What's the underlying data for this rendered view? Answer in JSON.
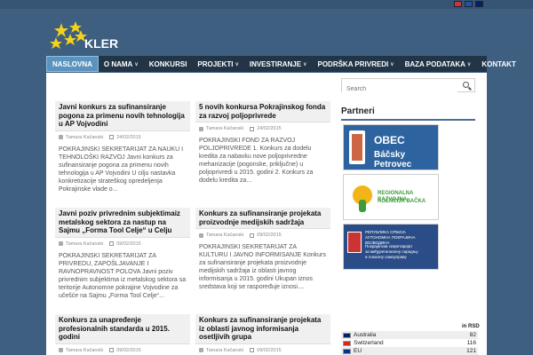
{
  "header": {
    "logo_text": "KLER",
    "languages": [
      {
        "code": "sr",
        "color": "#c6363c"
      },
      {
        "code": "ru",
        "color": "#1c57a5"
      },
      {
        "code": "en",
        "color": "#012169"
      }
    ]
  },
  "nav": {
    "items": [
      {
        "label": "NASLOVNA",
        "active": true,
        "has_menu": false
      },
      {
        "label": "O NAMA",
        "active": false,
        "has_menu": true
      },
      {
        "label": "KONKURSI",
        "active": false,
        "has_menu": false
      },
      {
        "label": "PROJEKTI",
        "active": false,
        "has_menu": true
      },
      {
        "label": "INVESTIRANJE",
        "active": false,
        "has_menu": true
      },
      {
        "label": "PODRŠKA PRIVREDI",
        "active": false,
        "has_menu": true
      },
      {
        "label": "BAZA PODATAKA",
        "active": false,
        "has_menu": true
      },
      {
        "label": "KONTAKT",
        "active": false,
        "has_menu": false
      }
    ]
  },
  "posts": [
    {
      "title": "Javni konkurs za sufinansiranje pogona za primenu novih tehnologija u AP Vojvodini",
      "author": "Tamara Kačanski",
      "date": "24/02/2015",
      "excerpt": "POKRAJINSKI SEKRETARIJAT ZA NAUKU I TEHNOLOŠKI RAZVOJ Javni konkurs za sufinansiranje pogona za primenu novih tehnologija u AP Vojvodini U cilju nastavka konkretizacije strateškog opredeljenja Pokrajinske vlade o..."
    },
    {
      "title": "5 novih konkursa Pokrajinskog fonda za razvoj poljoprivrede",
      "author": "Tamara Kačanski",
      "date": "24/02/2015",
      "excerpt": "POKRAJINSKI FOND ZA RAZVOJ POLJOPRIVREDE 1. Konkurs za dodelu kredita za nabavku nove poljoprivredne mehanizacije (pogonske, priključne)   u poljoprivredi u 2015. godini 2. Konkurs za dodelu kredita za..."
    },
    {
      "title": "Javni poziv privrednim subjektimaiz metalskog sektora za nastup na Sajmu „Forma Tool Celje“ u Celju",
      "author": "Tamara Kačanski",
      "date": "09/02/2015",
      "excerpt": "POKRAJINSKI SEKRETARIJAT ZA PRIVREDU, ZAPOŠLJAVANJE I RAVNOPRAVNOST POLOVA Javni poziv privrednim subjektima iz metalskog sektora sa teritorije Autonomne pokrajine Vojvodine za učešće na Sajmu „Forma Tool Celje“..."
    },
    {
      "title": "Konkurs za sufinansiranje projekata proizvodnje medijskih sadržaja",
      "author": "Tamara Kačanski",
      "date": "09/02/2015",
      "excerpt": "POKRAJINSKI SEKRETARIJAT ZA KULTURU I JAVNO INFORMISANJE Konkurs za sufinansiranje projekata proizvodnje medijskih sadržaja iz oblasti javnog informisanja u 2015. godini Ukupan iznos sredstava koji se raspoređuje iznosi...."
    },
    {
      "title": "Konkurs za unapređenje profesionalnih standarda u 2015. godini",
      "author": "Tamara Kačanski",
      "date": "09/02/2015",
      "excerpt": ""
    },
    {
      "title": "Konkurs za sufinansiranje projekata iz oblasti javnog informisanja osetljivih grupa",
      "author": "Tamara Kačanski",
      "date": "09/02/2015",
      "excerpt": ""
    }
  ],
  "sidebar": {
    "search_placeholder": "Search",
    "partners_title": "Partneri",
    "partner1": {
      "line1": "OBEC",
      "line2": "Báčsky Petrovec"
    },
    "partner2": {
      "line1": "REGIONALNA RAZVOJNA",
      "line2": "AGENCIJA BAČKA"
    },
    "partner3": {
      "line1": "РЕПУБЛИКА СРБИЈА",
      "line2": "АУТОНОМНА ПОКРАЈИНА ВОЈВОДИНА",
      "line3": "Покрајински секретаријат",
      "line4": "за међурегионалну сарадњу",
      "line5": "и локалну самоуправу"
    },
    "currency_header": "in RSD",
    "currencies": [
      {
        "name": "Australia",
        "value": "82",
        "flag_color": "#012169"
      },
      {
        "name": "Switzerland",
        "value": "116",
        "flag_color": "#d52b1e"
      },
      {
        "name": "EU",
        "value": "121",
        "flag_color": "#003399"
      }
    ]
  }
}
